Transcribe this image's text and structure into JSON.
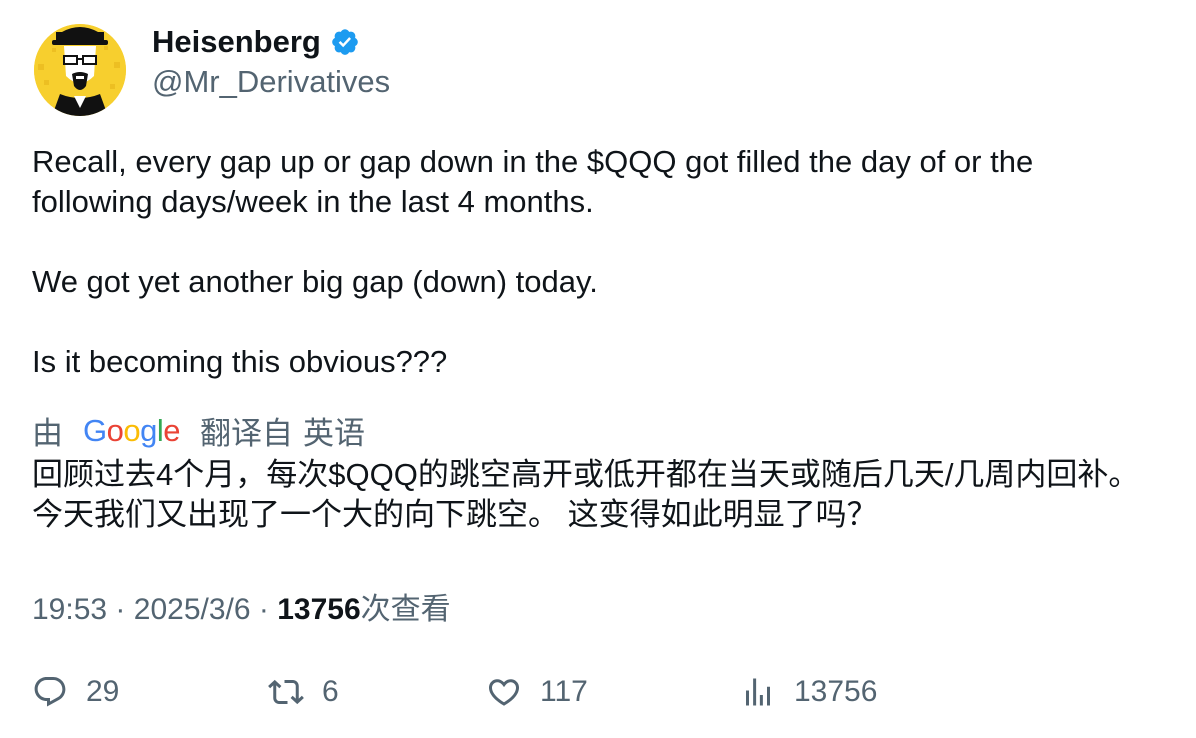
{
  "author": {
    "display_name": "Heisenberg",
    "handle": "@Mr_Derivatives",
    "verified_icon": "verified-badge-icon",
    "verified_color": "#1d9bf0",
    "avatar_icon": "heisenberg-avatar-icon",
    "avatar_bg": "#f7cf2e"
  },
  "tweet": {
    "paragraphs": [
      "Recall, every gap up or gap down in the $QQQ got filled the day of or the following days/week in the last 4 months.",
      "We got yet another big gap (down) today.",
      "Is it becoming this obvious???"
    ]
  },
  "translation": {
    "prefix": "由",
    "provider_letters": [
      "G",
      "o",
      "o",
      "g",
      "l",
      "e"
    ],
    "label": "翻译自",
    "language": "英语",
    "text": "回顾过去4个月，每次$QQQ的跳空高开或低开都在当天或随后几天/几周内回补。 今天我们又出现了一个大的向下跳空。 这变得如此明显了吗？"
  },
  "meta": {
    "time": "19:53",
    "separator": "·",
    "date": "2025/3/6",
    "views_count": "13756",
    "views_label": "次查看"
  },
  "actions": {
    "reply": {
      "icon": "reply-icon",
      "count": "29"
    },
    "retweet": {
      "icon": "retweet-icon",
      "count": "6"
    },
    "like": {
      "icon": "heart-icon",
      "count": "117"
    },
    "views": {
      "icon": "views-chart-icon",
      "count": "13756"
    }
  },
  "colors": {
    "text_primary": "#0f1419",
    "text_secondary": "#536471",
    "google_blue": "#4285F4",
    "google_red": "#EA4335",
    "google_yellow": "#FBBC05",
    "google_green": "#34A853"
  }
}
